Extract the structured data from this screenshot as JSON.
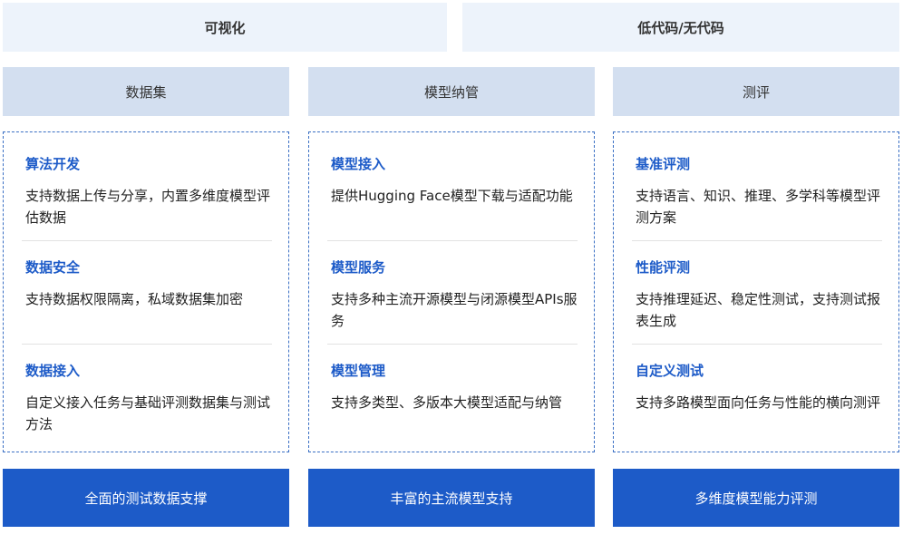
{
  "top": {
    "left_label": "可视化",
    "right_label": "低代码/无代码"
  },
  "columns": [
    {
      "header": "数据集",
      "features": [
        {
          "title": "算法开发",
          "desc": "支持数据上传与分享，内置多维度模型评估数据"
        },
        {
          "title": "数据安全",
          "desc": "支持数据权限隔离，私域数据集加密"
        },
        {
          "title": "数据接入",
          "desc": "自定义接入任务与基础评测数据集与测试方法"
        }
      ],
      "footer": "全面的测试数据支撑"
    },
    {
      "header": "模型纳管",
      "features": [
        {
          "title": "模型接入",
          "desc": "提供Hugging Face模型下载与适配功能"
        },
        {
          "title": "模型服务",
          "desc": "支持多种主流开源模型与闭源模型APIs服务"
        },
        {
          "title": "模型管理",
          "desc": "支持多类型、多版本大模型适配与纳管"
        }
      ],
      "footer": "丰富的主流模型支持"
    },
    {
      "header": "测评",
      "features": [
        {
          "title": "基准评测",
          "desc": "支持语言、知识、推理、多学科等模型评测方案"
        },
        {
          "title": "性能评测",
          "desc": "支持推理延迟、稳定性测试，支持测试报表生成"
        },
        {
          "title": "自定义测试",
          "desc": "支持多路模型面向任务与性能的横向测评"
        }
      ],
      "footer": "多维度模型能力评测"
    }
  ]
}
